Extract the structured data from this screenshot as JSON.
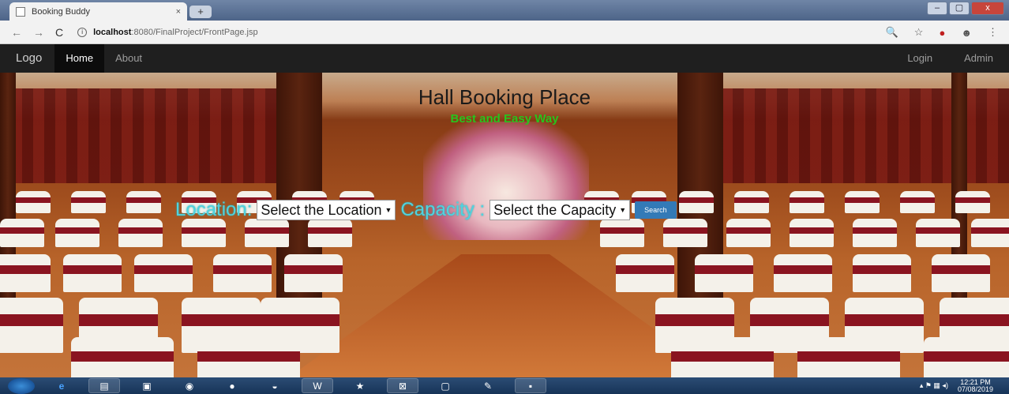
{
  "browser": {
    "tab_title": "Booking Buddy",
    "tab_close": "×",
    "new_tab": "+",
    "window_controls": {
      "minimize": "–",
      "maximize": "▢",
      "close": "x"
    },
    "nav": {
      "back": "←",
      "forward": "→",
      "reload": "C"
    },
    "url_host": "localhost",
    "url_path": ":8080/FinalProject/FrontPage.jsp",
    "right_icons": [
      "search-icon",
      "star-icon",
      "extension-icon",
      "profile-icon",
      "menu-icon"
    ]
  },
  "navbar": {
    "brand": "Logo",
    "left_items": [
      {
        "label": "Home",
        "active": true
      },
      {
        "label": "About",
        "active": false
      }
    ],
    "right_items": [
      {
        "label": "Login"
      },
      {
        "label": "Admin"
      }
    ]
  },
  "hero": {
    "title": "Hall Booking Place",
    "subtitle": "Best and Easy Way",
    "location_label": "Location:",
    "location_select": "Select the Location",
    "capacity_label": "Capacity :",
    "capacity_select": "Select the Capacity",
    "search_button": "Search"
  },
  "taskbar": {
    "apps": [
      "start-orb",
      "ie-icon",
      "explorer-icon",
      "outlook-icon",
      "chrome-icon",
      "firefox-icon",
      "eclipse-icon",
      "word-icon",
      "app-icon",
      "xampp-icon",
      "virtualbox-icon",
      "paint-icon",
      "cmd-icon"
    ],
    "time": "12:21 PM",
    "date": "07/08/2019"
  },
  "colors": {
    "navbar_bg": "#1f1f1f",
    "label_cyan": "#4fd3e0",
    "subtitle_green": "#27c41d",
    "button_blue": "#337ab7"
  }
}
